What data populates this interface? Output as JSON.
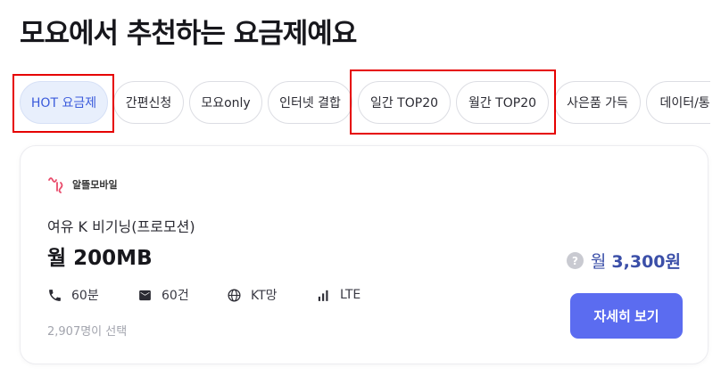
{
  "page_title": "모요에서 추천하는 요금제예요",
  "tabs": [
    {
      "label": "HOT 요금제",
      "active": true
    },
    {
      "label": "간편신청",
      "active": false
    },
    {
      "label": "모요only",
      "active": false
    },
    {
      "label": "인터넷 결합",
      "active": false
    },
    {
      "label": "일간 TOP20",
      "active": false
    },
    {
      "label": "월간 TOP20",
      "active": false
    },
    {
      "label": "사은품 가득",
      "active": false
    },
    {
      "label": "데이터/통화",
      "active": false
    }
  ],
  "plan": {
    "carrier": "알뜰모바일",
    "name": "여유 K 비기닝(프로모션)",
    "data": "월 200MB",
    "voice": "60분",
    "sms": "60건",
    "network": "KT망",
    "type": "LTE",
    "subscribers": "2,907명이 선택",
    "price_prefix": "월",
    "price": "3,300원",
    "help_icon": "?",
    "detail_button": "자세히 보기"
  },
  "colors": {
    "accent": "#5b6cf0",
    "active_tab_bg": "#e8effc",
    "active_tab_text": "#3b5bdb",
    "price_text": "#3b4fa8",
    "highlight": "#e60000"
  }
}
